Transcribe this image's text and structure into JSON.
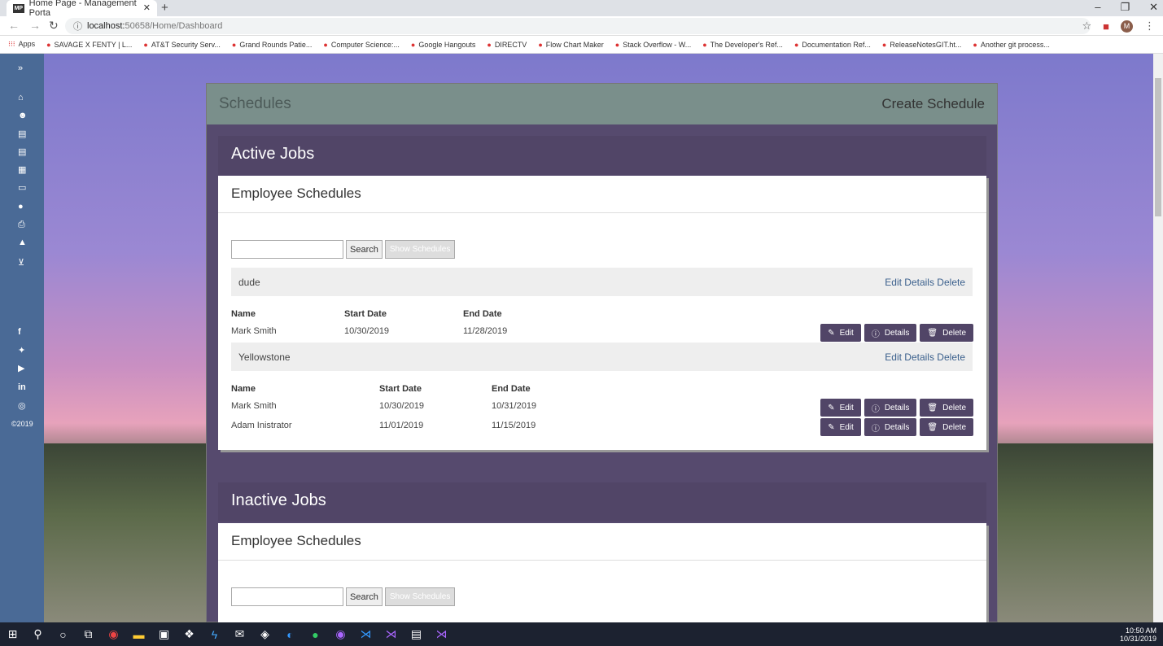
{
  "browser": {
    "tab_title": "Home Page - Management Porta",
    "tab_icon": "MP",
    "url_host": "localhost:",
    "url_path": "50658/Home/Dashboard",
    "bookmarks": [
      "Apps",
      "SAVAGE X FENTY | L...",
      "AT&T Security Serv...",
      "Grand Rounds Patie...",
      "Computer Science:...",
      "Google Hangouts",
      "DIRECTV",
      "Flow Chart Maker",
      "Stack Overflow - W...",
      "The Developer's Ref...",
      "Documentation Ref...",
      "ReleaseNotesGIT.ht...",
      "Another git process..."
    ],
    "avatar": "M"
  },
  "sidebar": {
    "copyright": "©2019"
  },
  "header": {
    "title": "Schedules",
    "create": "Create Schedule"
  },
  "active": {
    "title": "Active Jobs",
    "card_title": "Employee Schedules",
    "search_btn": "Search",
    "show_btn": "Show Schedules",
    "jobs": [
      {
        "name": "dude",
        "links": "Edit Details Delete",
        "cols": [
          "Name",
          "Start Date",
          "End Date"
        ],
        "rows": [
          [
            "Mark Smith",
            "10/30/2019",
            "11/28/2019"
          ]
        ]
      },
      {
        "name": "Yellowstone",
        "links": "Edit Details Delete",
        "cols": [
          "Name",
          "Start Date",
          "End Date"
        ],
        "rows": [
          [
            "Mark Smith",
            "10/30/2019",
            "10/31/2019"
          ],
          [
            "Adam Inistrator",
            "11/01/2019",
            "11/15/2019"
          ]
        ]
      }
    ]
  },
  "inactive": {
    "title": "Inactive Jobs",
    "card_title": "Employee Schedules",
    "search_btn": "Search",
    "show_btn": "Show Schedules"
  },
  "buttons": {
    "edit": "Edit",
    "details": "Details",
    "delete": "Delete"
  },
  "clock": {
    "time": "10:50 AM",
    "date": "10/31/2019"
  }
}
